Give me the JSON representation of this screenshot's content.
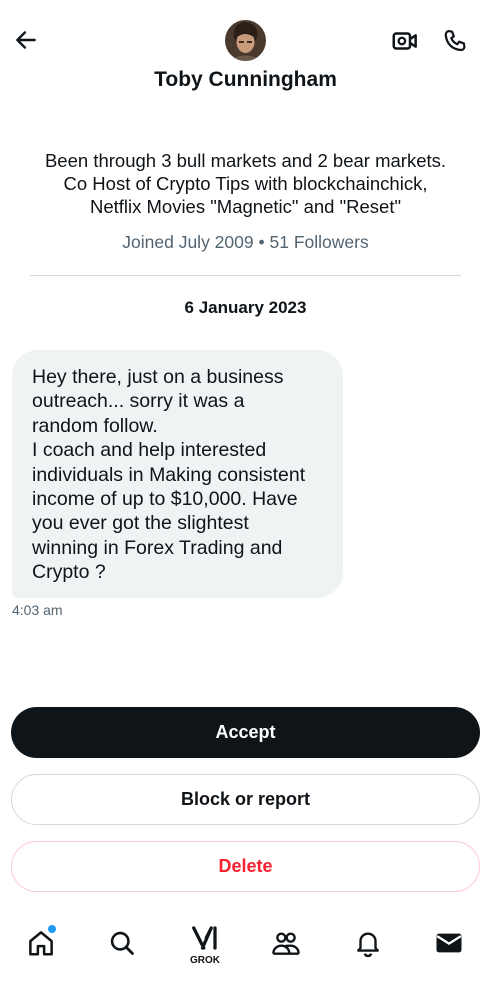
{
  "header": {
    "name": "Toby Cunningham"
  },
  "profile": {
    "bio_lines": [
      "Been through 3 bull markets and 2 bear markets.",
      "Co Host of Crypto Tips with blockchainchick,",
      "Netflix Movies \"Magnetic\" and \"Reset\""
    ],
    "joined": "Joined July 2009",
    "separator": "•",
    "followers": "51 Followers"
  },
  "conversation": {
    "date": "6 January 2023",
    "message": {
      "lines": [
        "Hey there, just on a business",
        "outreach... sorry it was a",
        "random follow.",
        "I coach and help interested",
        "individuals in Making consistent",
        "income of up to $10,000. Have",
        "you ever got the slightest",
        "winning in Forex Trading and",
        "Crypto ?"
      ],
      "time": "4:03 am"
    }
  },
  "actions": {
    "accept": "Accept",
    "block": "Block or report",
    "delete": "Delete"
  },
  "nav": {
    "items": [
      "home-icon",
      "search-icon",
      "grok-icon",
      "communities-icon",
      "notifications-icon",
      "messages-icon"
    ],
    "grok_label": "GROK",
    "home_has_notification": true
  },
  "colors": {
    "primary_text": "#0f1419",
    "secondary_text": "#536471",
    "bubble_bg": "#eff3f4",
    "danger": "#f4212e",
    "accent": "#1d9bf0"
  }
}
